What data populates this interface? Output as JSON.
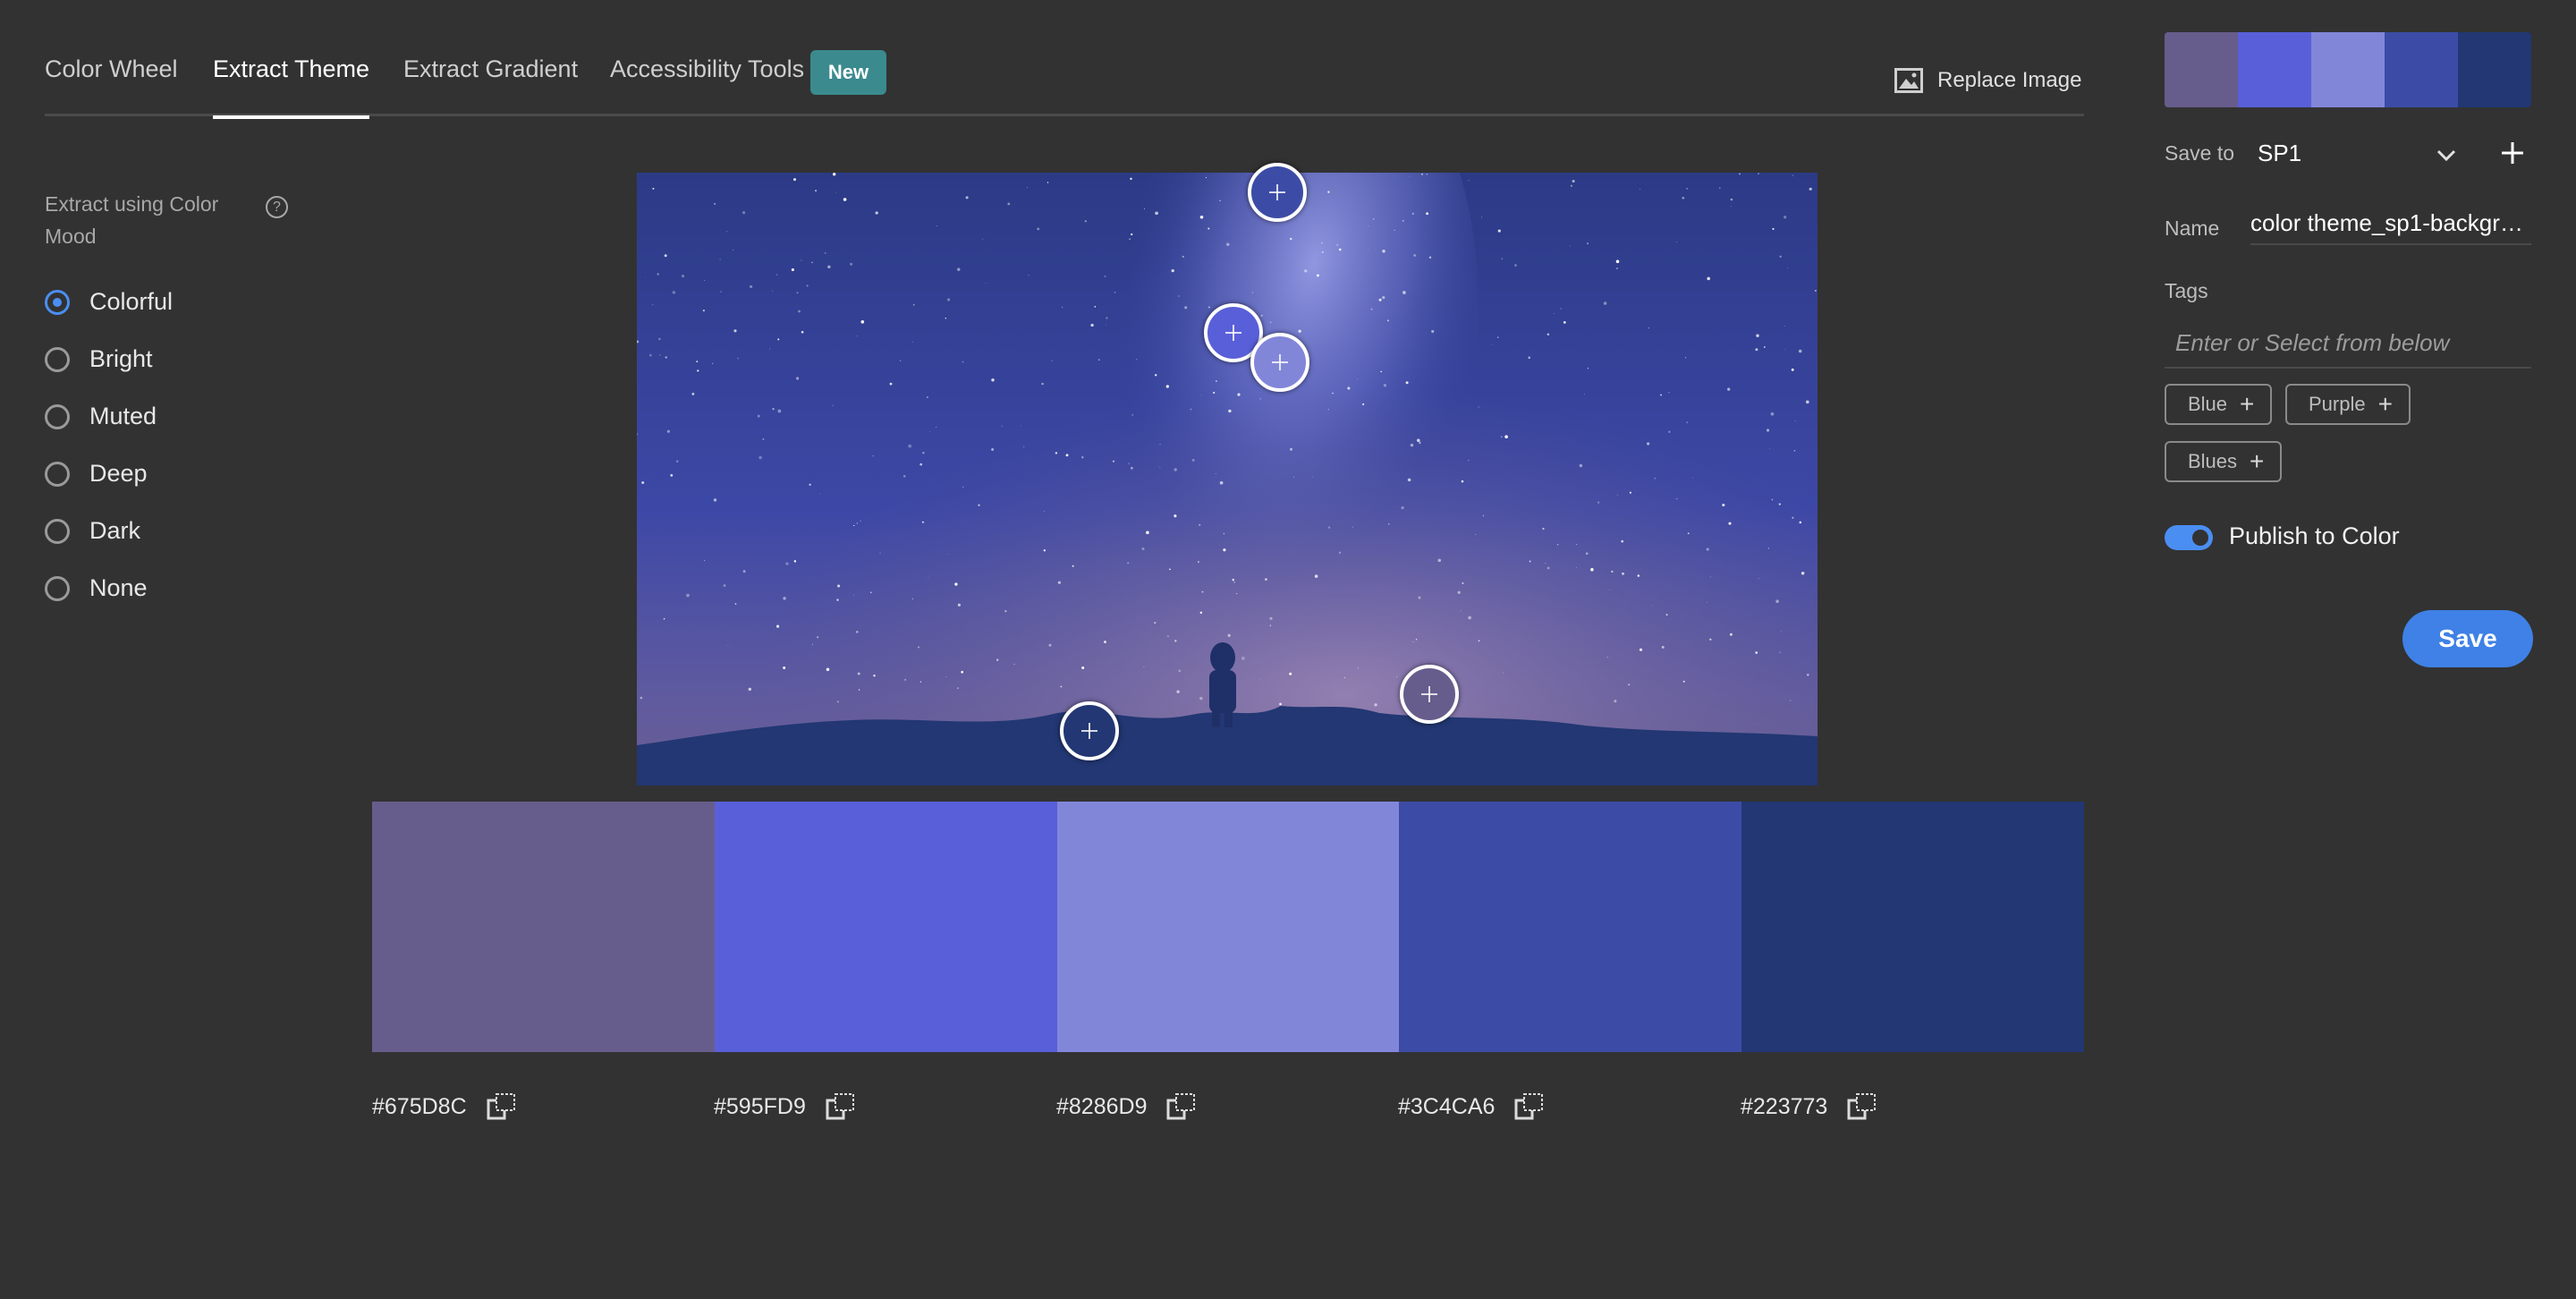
{
  "nav": {
    "tabs": [
      {
        "label": "Color Wheel"
      },
      {
        "label": "Extract Theme"
      },
      {
        "label": "Extract Gradient"
      },
      {
        "label": "Accessibility Tools"
      }
    ],
    "active_tab": "Extract Theme",
    "new_badge": "New",
    "replace_image": "Replace Image",
    "replace_icon": "image-icon"
  },
  "mood": {
    "label": "Extract using Color Mood",
    "help_icon": "?",
    "options": [
      "Colorful",
      "Bright",
      "Muted",
      "Deep",
      "Dark",
      "None"
    ],
    "selected": "Colorful"
  },
  "theme": {
    "colors": [
      {
        "hex": "#675D8C"
      },
      {
        "hex": "#595FD9"
      },
      {
        "hex": "#8286D9"
      },
      {
        "hex": "#3C4CA6"
      },
      {
        "hex": "#223773"
      }
    ],
    "copy_icon": "copy-icon"
  },
  "save_panel": {
    "save_to_label": "Save to",
    "save_to_value": "SP1",
    "name_label": "Name",
    "name_value": "color theme_sp1-backgro...",
    "tags_label": "Tags",
    "tags_placeholder": "Enter or Select from below",
    "suggested_tags": [
      {
        "label": "Blue",
        "plus": "+"
      },
      {
        "label": "Purple",
        "plus": "+"
      },
      {
        "label": "Blues",
        "plus": "+"
      }
    ],
    "publish_label": "Publish to Color",
    "publish_enabled": true,
    "save_button": "Save",
    "accent_color": "#4b8ef2"
  }
}
